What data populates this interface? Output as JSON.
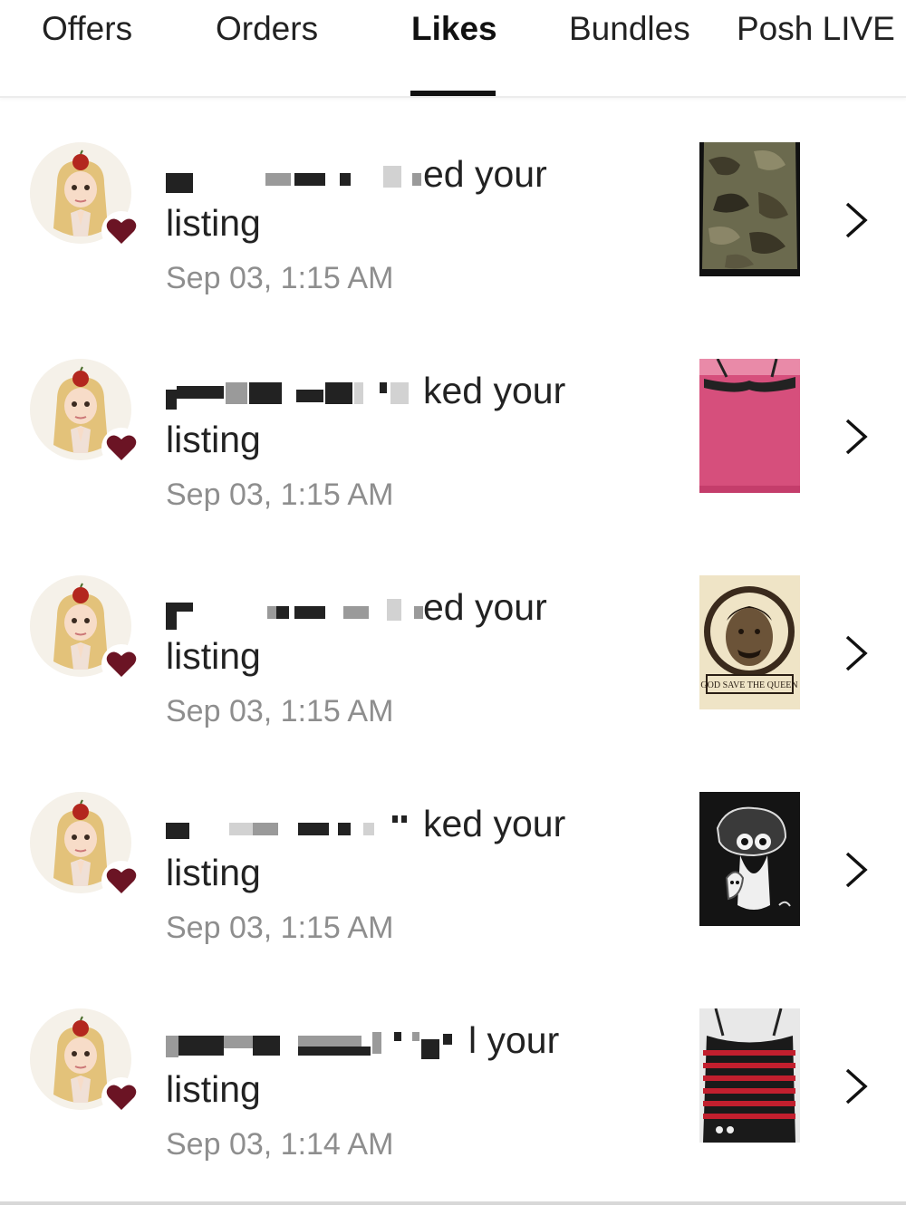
{
  "tabs": [
    {
      "label": "Offers"
    },
    {
      "label": "Orders"
    },
    {
      "label": "Likes",
      "active": true
    },
    {
      "label": "Bundles"
    },
    {
      "label": "Posh LIVE"
    }
  ],
  "notifications": [
    {
      "action_text": "ed your",
      "second_line": "listing",
      "timestamp": "Sep 03, 1:15 AM",
      "item": "camouflage-item-photo"
    },
    {
      "action_text": "ked your",
      "second_line": "listing",
      "timestamp": "Sep 03, 1:15 AM",
      "item": "pink-top-photo"
    },
    {
      "action_text": "ed your",
      "second_line": "listing",
      "timestamp": "Sep 03, 1:15 AM",
      "item": "queen-tshirt-photo"
    },
    {
      "action_text": "ked your",
      "second_line": "listing",
      "timestamp": "Sep 03, 1:15 AM",
      "item": "black-graphic-tshirt-photo"
    },
    {
      "action_text": "l your",
      "second_line": "listing",
      "timestamp": "Sep 03, 1:14 AM",
      "item": "striped-top-photo"
    }
  ],
  "colors": {
    "heart": "#6b1424",
    "timestamp": "#8e8e8e",
    "active_tab_underline": "#111111"
  },
  "icons": {
    "chevron": "chevron-right-icon",
    "heart": "heart-icon",
    "avatar": "user-avatar"
  },
  "thumb_caption_3": "GOD SAVE THE QUEEN"
}
